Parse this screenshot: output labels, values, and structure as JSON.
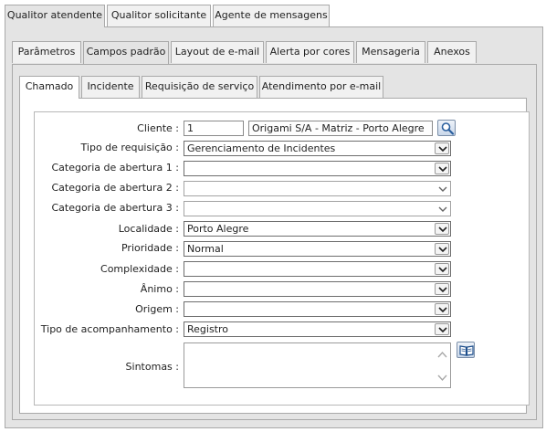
{
  "tabs_level1": [
    {
      "label": "Qualitor atendente",
      "active": true
    },
    {
      "label": "Qualitor solicitante",
      "active": false
    },
    {
      "label": "Agente de mensagens",
      "active": false
    }
  ],
  "tabs_level2": [
    {
      "label": "Parâmetros",
      "active": false
    },
    {
      "label": "Campos padrão",
      "active": true
    },
    {
      "label": "Layout de e-mail",
      "active": false
    },
    {
      "label": "Alerta por cores",
      "active": false
    },
    {
      "label": "Mensageria",
      "active": false
    },
    {
      "label": "Anexos",
      "active": false
    }
  ],
  "tabs_level3": [
    {
      "label": "Chamado",
      "active": true
    },
    {
      "label": "Incidente",
      "active": false
    },
    {
      "label": "Requisição de serviço",
      "active": false
    },
    {
      "label": "Atendimento por e-mail",
      "active": false
    }
  ],
  "form": {
    "cliente": {
      "label": "Cliente :",
      "code": "1",
      "name": "Origami S/A - Matriz - Porto Alegre"
    },
    "tipo_requisicao": {
      "label": "Tipo de requisição :",
      "value": "Gerenciamento de Incidentes"
    },
    "categoria1": {
      "label": "Categoria de abertura 1 :",
      "value": ""
    },
    "categoria2": {
      "label": "Categoria de abertura 2 :",
      "value": ""
    },
    "categoria3": {
      "label": "Categoria de abertura 3 :",
      "value": ""
    },
    "localidade": {
      "label": "Localidade :",
      "value": "Porto Alegre"
    },
    "prioridade": {
      "label": "Prioridade :",
      "value": "Normal"
    },
    "complexidade": {
      "label": "Complexidade :",
      "value": ""
    },
    "animo": {
      "label": "Ânimo :",
      "value": ""
    },
    "origem": {
      "label": "Origem :",
      "value": ""
    },
    "tipo_acompanhamento": {
      "label": "Tipo de acompanhamento :",
      "value": "Registro"
    },
    "sintomas": {
      "label": "Sintomas :",
      "value": ""
    }
  },
  "icons": {
    "search": "search-icon",
    "book": "book-icon"
  },
  "colors": {
    "panel_gray": "#e4e4e4",
    "border": "#a9a9a9",
    "icon_blue": "#2a5f9e"
  }
}
